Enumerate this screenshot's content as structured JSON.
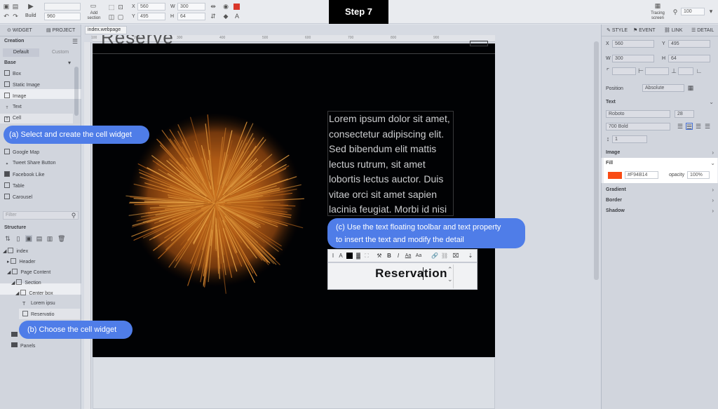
{
  "step_title": "Step 7",
  "toolbar": {
    "build": "Build",
    "width_field": "960",
    "add_section": "Add section",
    "x_label": "X",
    "x_value": "560",
    "y_label": "Y",
    "y_value": "495",
    "w_label": "W",
    "w_value": "300",
    "h_label": "H",
    "h_value": "64",
    "tracing": "Tracing screen",
    "zoom": "100"
  },
  "left": {
    "tab_widget": "WIDGET",
    "tab_project": "PROJECT",
    "creation": "Creation",
    "default_tab": "Default",
    "custom_tab": "Custom",
    "base": "Base",
    "widgets": [
      "Box",
      "Static Image",
      "Image",
      "Text",
      "Cell",
      "Google Map",
      "Tweet Share Button",
      "Facebook Like",
      "Table",
      "Carousel"
    ],
    "filter_placeholder": "Filter",
    "structure": "Structure",
    "tree": [
      "index",
      "Header",
      "Page Content",
      "Section",
      "Center box",
      "Lorem ipsu",
      "Reservatio",
      "Panels"
    ]
  },
  "doc_tab": "index.webpage",
  "ruler": [
    "100",
    "200",
    "300",
    "400",
    "500",
    "600",
    "700",
    "800",
    "900"
  ],
  "stage": {
    "heading": "Reserve",
    "lorem": "Lorem ipsum dolor sit amet, consectetur adipiscing elit. Sed bibendum elit mattis lectus rutrum, sit amet lobortis lectus auctor. Duis vitae orci sit amet sapien lacinia feugiat. Morbi id nisi",
    "reservation": "Reservation"
  },
  "bubbles": {
    "a": "(a) Select and create the cell widget",
    "b": "(b) Choose the cell widget",
    "c1": "(c) Use the text floating toolbar and text property",
    "c2": "to insert the text and modify the detail"
  },
  "right": {
    "tab_style": "STYLE",
    "tab_event": "EVENT",
    "tab_link": "LINK",
    "tab_detail": "DETAIL",
    "x": "560",
    "y": "495",
    "w": "300",
    "h": "64",
    "position_label": "Position",
    "position_value": "Absolute",
    "text_label": "Text",
    "font": "Roboto",
    "font_size": "28",
    "weight": "700 Bold",
    "line": "1",
    "image_label": "Image",
    "fill_label": "Fill",
    "fill_hex": "#F94B14",
    "opacity_label": "opacity",
    "opacity_value": "100%",
    "gradient_label": "Gradient",
    "border_label": "Border",
    "shadow_label": "Shadow"
  },
  "colors": {
    "fill": "#F94B14",
    "accent": "#4f7de8"
  }
}
